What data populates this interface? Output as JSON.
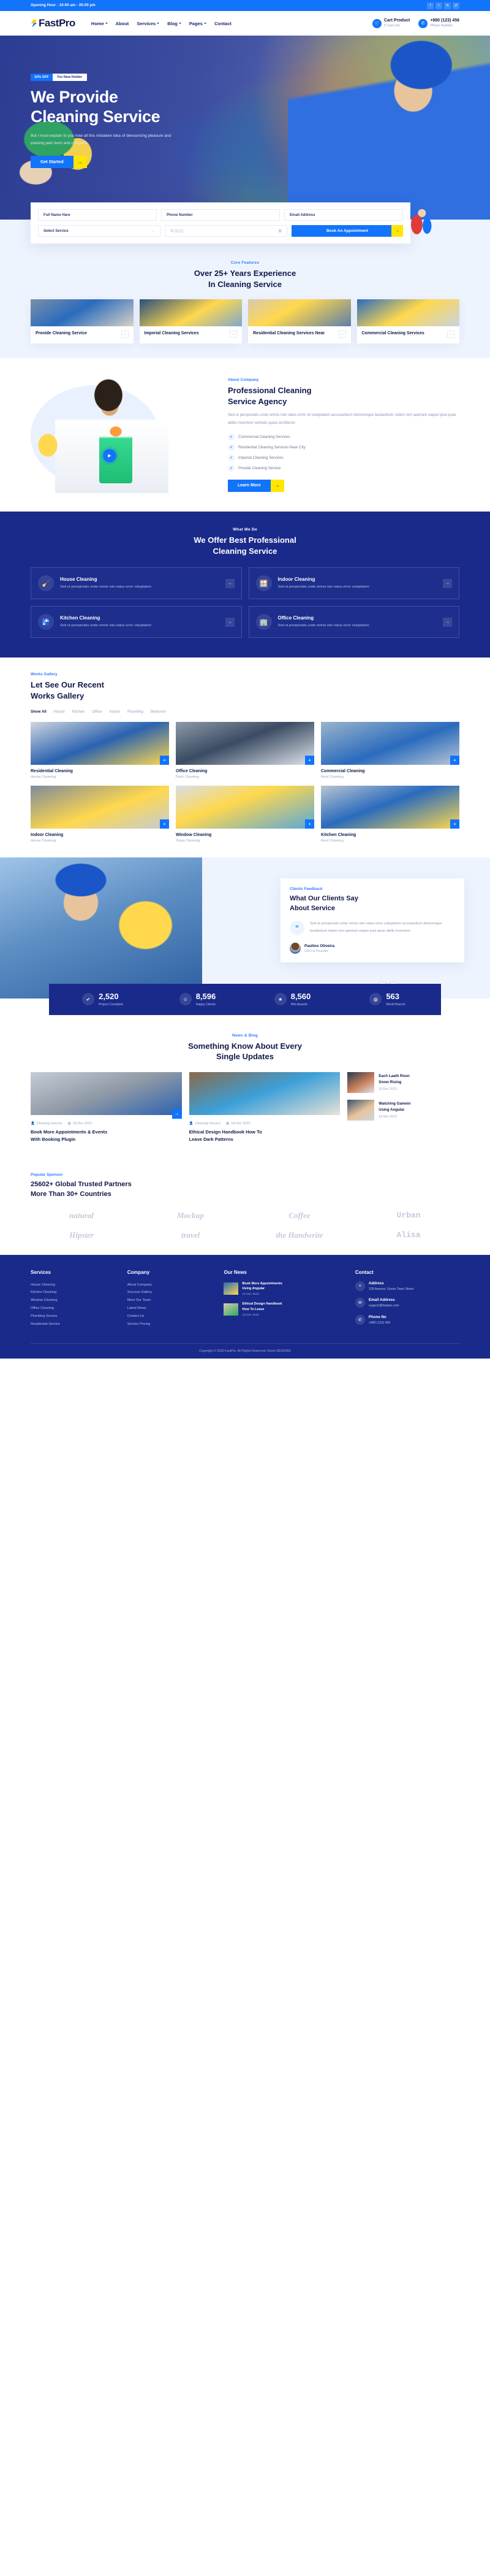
{
  "topbar": {
    "hours": "Opening Hour : 10:00 am - 05:00 pm",
    "social": [
      "f",
      "t",
      "in",
      "yt"
    ]
  },
  "nav": {
    "logo": "FastPro",
    "menu": [
      {
        "label": "Home",
        "caret": true
      },
      {
        "label": "About",
        "caret": false
      },
      {
        "label": "Services",
        "caret": true
      },
      {
        "label": "Blog",
        "caret": true
      },
      {
        "label": "Pages",
        "caret": true
      },
      {
        "label": "Contact",
        "caret": false
      }
    ],
    "cart": {
      "title": "Cart Product",
      "sub": "0 Cart List",
      "icon": "cart-icon"
    },
    "phone": {
      "title": "+880 (123) 456",
      "sub": "Phone Number",
      "icon": "phone-icon"
    }
  },
  "hero": {
    "badge_off": "10% OFF",
    "badge_text": "For New Holder",
    "title_line1": "We Provide",
    "title_line2": "Cleaning Service",
    "desc": "But I must explain to you how all this mistaken idea of denouncing pleasure and praising pain born and complete",
    "cta": "Get Started",
    "cta_arrow": "→"
  },
  "booking": {
    "name_placeholder": "Full Name Hare",
    "phone_placeholder": "Phone Number",
    "email_placeholder": "Email Address",
    "service_placeholder": "Select Service",
    "date_placeholder": "年/月/日",
    "submit": "Book An Appointment",
    "submit_arrow": "→"
  },
  "features": {
    "label": "Core Features",
    "title_line1": "Over 25+ Years Experience",
    "title_line2": "In Cleaning Service",
    "cards": [
      {
        "name": "Provide Cleaning Service",
        "arrow": "→"
      },
      {
        "name": "Imperial Cleaning Services",
        "arrow": "→"
      },
      {
        "name": "Residential Cleaning Services Near",
        "arrow": "→"
      },
      {
        "name": "Commercial Cleaning Services",
        "arrow": "→"
      }
    ]
  },
  "about": {
    "label": "About Company",
    "title_line1": "Professional Cleaning",
    "title_line2": "Service Agency",
    "desc": "Sed ut perspiciatis unde omnis iste natus error sit voluptatem accusantium doloremque laudantium, totam rem aperiam eaque ipsa quae abillo inventore veritatis quasi architecto",
    "list": [
      "Commercial Cleaning Services",
      "Residential Cleaning Services Near City",
      "Imperial Cleaning Services",
      "Provide Cleaning Service"
    ],
    "cta": "Learn More",
    "cta_arrow": "→",
    "play_icon": "play-icon"
  },
  "whatwedo": {
    "label": "What We Do",
    "title_line1": "We Offer Best Professional",
    "title_line2": "Cleaning Service",
    "cards": [
      {
        "name": "House Cleaning",
        "desc": "Sed ut perspiciatis unde omnis iste natus error voluptatem",
        "icon": "broom-icon",
        "arrow": "→"
      },
      {
        "name": "Indoor Cleaning",
        "desc": "Sed ut perspiciatis unde omnis iste natus error voluptatem",
        "icon": "window-icon",
        "arrow": "→"
      },
      {
        "name": "Kitchen Cleaning",
        "desc": "Sed ut perspiciatis unde omnis iste natus error voluptatem",
        "icon": "sink-icon",
        "arrow": "→"
      },
      {
        "name": "Office Cleaning",
        "desc": "Sed ut perspiciatis unde omnis iste natus error voluptatem",
        "icon": "office-icon",
        "arrow": "→"
      }
    ]
  },
  "gallery": {
    "label": "Works Gallery",
    "title_line1": "Let See Our Recent",
    "title_line2": "Works Gallery",
    "filters": [
      "Show All",
      "House",
      "Kitchen",
      "Office",
      "Indoor",
      "Plumbing",
      "Bedroom"
    ],
    "active_filter": "Show All",
    "items": [
      {
        "title": "Residential Cleaning",
        "sub": "House Cleaning",
        "plus": "+"
      },
      {
        "title": "Office Cleaning",
        "sub": "Desk Cleaning",
        "plus": "+"
      },
      {
        "title": "Commercial Cleaning",
        "sub": "Roof Cleaning",
        "plus": "+"
      },
      {
        "title": "Indoor Cleaning",
        "sub": "House Cleaning",
        "plus": "+"
      },
      {
        "title": "Window Cleaning",
        "sub": "Glass Cleaning",
        "plus": "+"
      },
      {
        "title": "Kitchen Cleaning",
        "sub": "Roof Cleaning",
        "plus": "+"
      }
    ]
  },
  "testimonial": {
    "label": "Clients Feedback",
    "title_line1": "What Our Clients Say",
    "title_line2": "About Service",
    "quote_icon": "“",
    "text": "Sed ut perspiciatis unde omnis iste natus error voluptatem accusantium doloremque laudantium totam rem aperiam eaque ipsa quae abillo inventore",
    "person_name": "Paulino Oliveira",
    "person_role": "CEO & Founder",
    "prev": "←",
    "next": "→"
  },
  "counters": [
    {
      "num": "2,520",
      "label": "Project Complete",
      "icon": "project-icon"
    },
    {
      "num": "8,596",
      "label": "Happy Clients",
      "icon": "smile-icon"
    },
    {
      "num": "8,560",
      "label": "Win Awards",
      "icon": "award-icon"
    },
    {
      "num": "563",
      "label": "World Branch",
      "icon": "globe-icon"
    }
  ],
  "blog": {
    "label": "News & Blog",
    "title_line1": "Something Know About Every",
    "title_line2": "Single Updates",
    "posts": [
      {
        "meta_user": "Cleaning Service",
        "meta_date": "18 Dec 2023",
        "title_line1": "Book More Appointments & Events",
        "title_line2": "With Booking Plugin",
        "arrow": "→"
      },
      {
        "meta_user": "Cleaning Service",
        "meta_date": "18 Dec 2023",
        "title_line1": "Ethical Design Handbook How To",
        "title_line2": "Leave Dark Patterns",
        "arrow": "→"
      }
    ],
    "side_posts": [
      {
        "title_line1": "Each Laath Roon",
        "title_line2": "Snow Rising",
        "date": "18 Dec 2023"
      },
      {
        "title_line1": "Watching Gamein",
        "title_line2": "Using Angular",
        "date": "18 Dec 2023"
      }
    ]
  },
  "partners": {
    "label": "Popular Sponsor",
    "title_line1": "25602+ Global Trusted Partners",
    "title_line2": "More Than 30+ Countries",
    "brands": [
      "natural",
      "Mockup",
      "Coffee",
      "Urban",
      "Hipster",
      "travel",
      "the Handwrite",
      "Alisa"
    ]
  },
  "footer": {
    "columns": [
      {
        "heading": "Services",
        "items": [
          "House Cleaning",
          "Kitchen Cleaning",
          "Window Cleaning",
          "Office Cleaning",
          "Plumbing Service",
          "Residential Service"
        ]
      },
      {
        "heading": "Company",
        "items": [
          "About Company",
          "Success Gallery",
          "Meet Our Team",
          "Latest News",
          "Contact Us",
          "Service Pricing"
        ]
      }
    ],
    "news_heading": "Our News",
    "news": [
      {
        "title_line1": "Book More Appointments",
        "title_line2": "Using Angular",
        "date": "18 Dec 2023"
      },
      {
        "title_line1": "Ethical Design Handbook",
        "title_line2": "How To Leave",
        "date": "18 Dec 2023"
      }
    ],
    "contact_heading": "Contact",
    "contacts": [
      {
        "title": "Address",
        "sub": "128 Avenue, Green Town Street",
        "icon": "location-icon"
      },
      {
        "title": "Email Address",
        "sub": "support@fastpro.com",
        "icon": "mail-icon"
      },
      {
        "title": "Phone No",
        "sub": "+880 (123) 456",
        "icon": "phone-icon"
      }
    ],
    "copyright": "Copyright © 2023 FastPro. All Rights Reserved. Demo DESIGNS"
  }
}
